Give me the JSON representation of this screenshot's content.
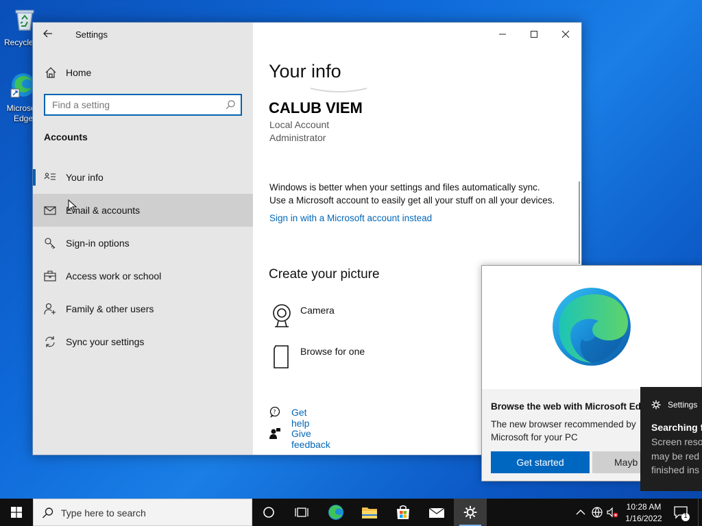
{
  "desktop": {
    "icons": [
      {
        "label": "Recycle Bin"
      },
      {
        "label": "Microsoft Edge"
      }
    ]
  },
  "window": {
    "title": "Settings",
    "sidebar": {
      "home_label": "Home",
      "search_placeholder": "Find a setting",
      "section_heading": "Accounts",
      "items": [
        {
          "label": "Your info",
          "icon": "contact-card-icon",
          "active": true
        },
        {
          "label": "Email & accounts",
          "icon": "mail-icon"
        },
        {
          "label": "Sign-in options",
          "icon": "key-icon"
        },
        {
          "label": "Access work or school",
          "icon": "briefcase-icon"
        },
        {
          "label": "Family & other users",
          "icon": "person-add-icon"
        },
        {
          "label": "Sync your settings",
          "icon": "sync-icon"
        }
      ]
    },
    "main": {
      "title": "Your info",
      "user_name": "CALUB VIEM",
      "account_type": "Local Account",
      "account_role": "Administrator",
      "sync_line1": "Windows is better when your settings and files automatically sync.",
      "sync_line2": "Use a Microsoft account to easily get all your stuff on all your devices.",
      "ms_link": "Sign in with a Microsoft account instead",
      "picture_heading": "Create your picture",
      "camera_label": "Camera",
      "browse_label": "Browse for one",
      "help_label": "Get help",
      "feedback_label": "Give feedback"
    }
  },
  "edge_popup": {
    "title": "Browse the web with Microsoft Ed",
    "description": "The new browser recommended by Microsoft for your PC",
    "primary_button": "Get started",
    "secondary_button": "Mayb"
  },
  "toast": {
    "app_name": "Settings",
    "title": "Searching f",
    "line1": "Screen reso",
    "line2": "may be red",
    "line3": "finished ins"
  },
  "taskbar": {
    "search_placeholder": "Type here to search",
    "time": "10:28 AM",
    "date": "1/16/2022",
    "notification_count": "1"
  },
  "colors": {
    "accent": "#0063b1",
    "link": "#0067b8",
    "edge_button": "#0067c0"
  }
}
